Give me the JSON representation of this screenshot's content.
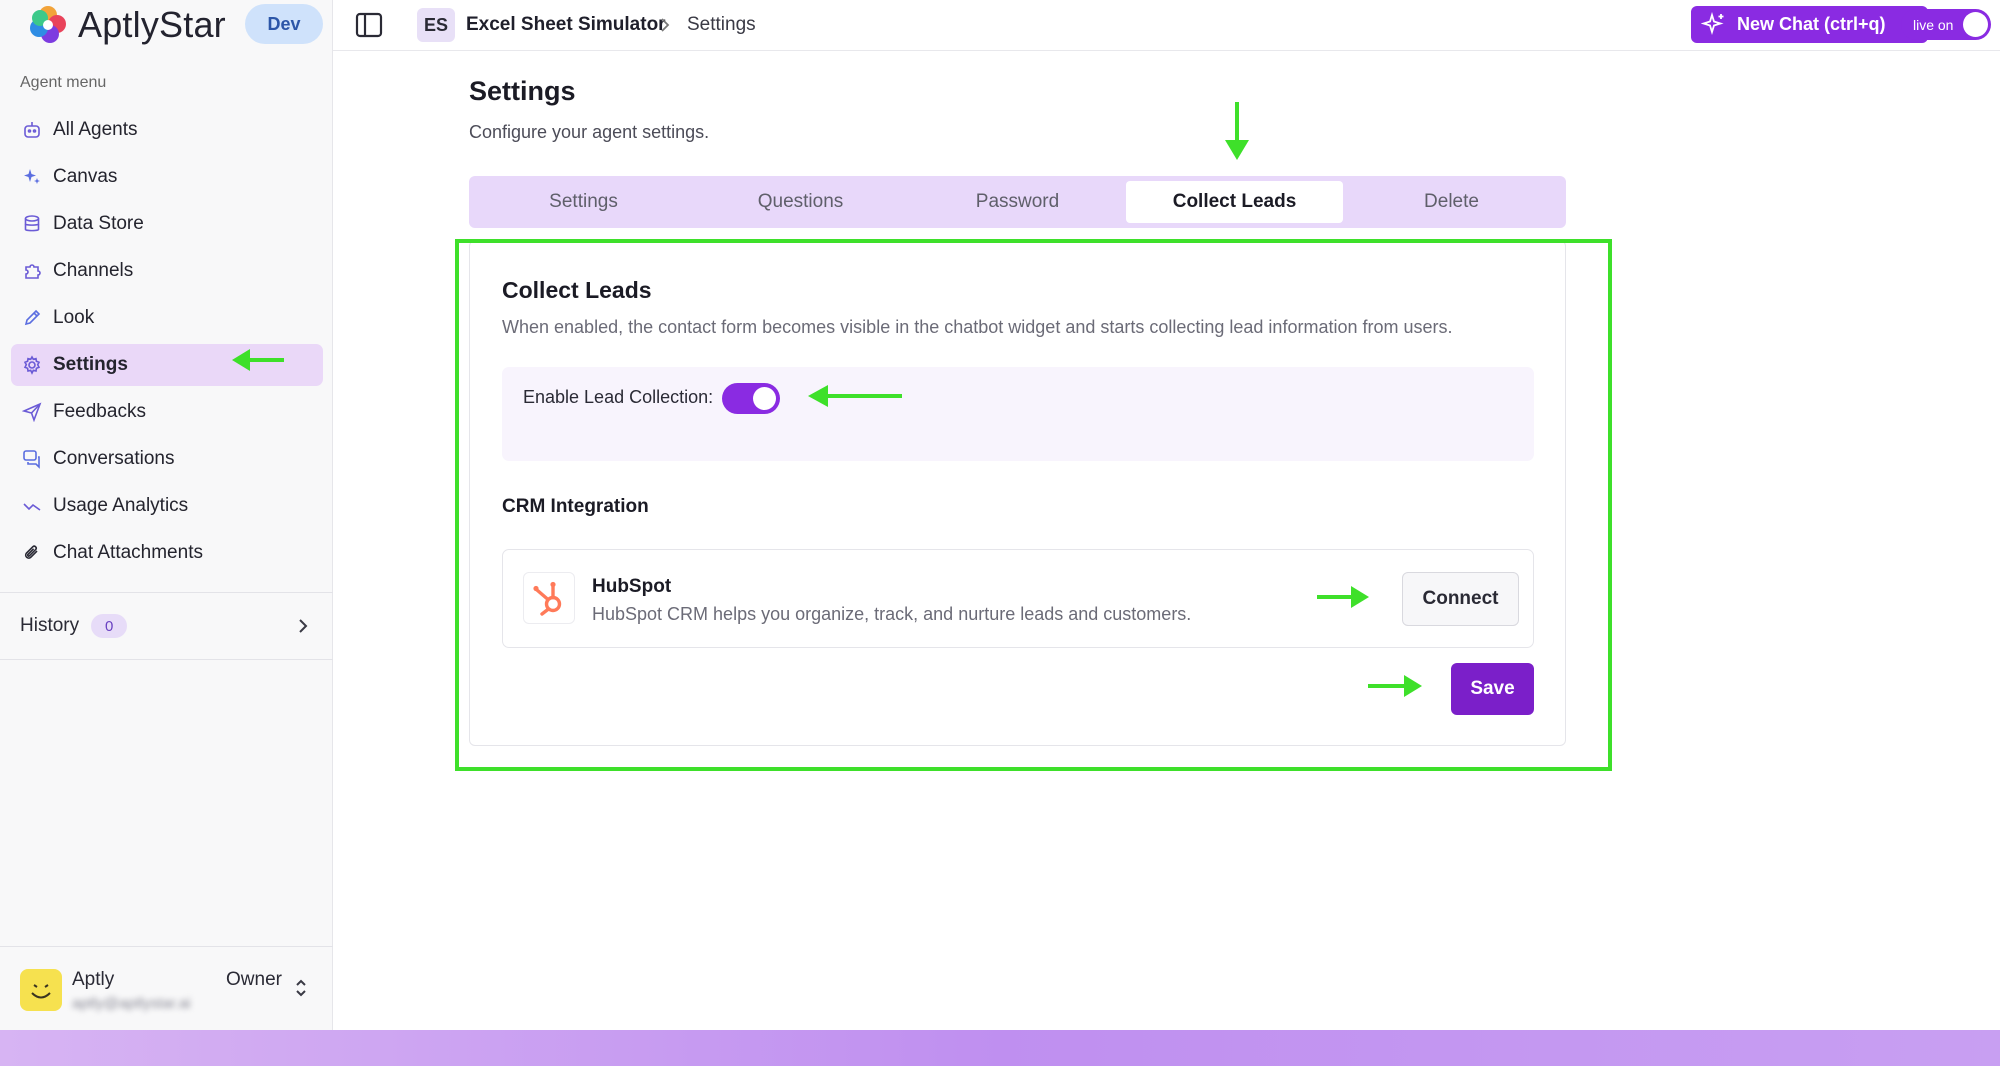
{
  "brand": {
    "name": "AptlyStar",
    "env_badge": "Dev"
  },
  "sidebar": {
    "section_label": "Agent menu",
    "items": [
      {
        "label": "All Agents",
        "icon": "robot-icon",
        "active": false
      },
      {
        "label": "Canvas",
        "icon": "sparkles-icon",
        "active": false
      },
      {
        "label": "Data Store",
        "icon": "database-icon",
        "active": false
      },
      {
        "label": "Channels",
        "icon": "puzzle-icon",
        "active": false
      },
      {
        "label": "Look",
        "icon": "eyedropper-icon",
        "active": false
      },
      {
        "label": "Settings",
        "icon": "gear-icon",
        "active": true
      },
      {
        "label": "Feedbacks",
        "icon": "send-icon",
        "active": false
      },
      {
        "label": "Conversations",
        "icon": "chat-icon",
        "active": false
      },
      {
        "label": "Usage Analytics",
        "icon": "trend-icon",
        "active": false
      },
      {
        "label": "Chat Attachments",
        "icon": "paperclip-icon",
        "active": false
      }
    ],
    "history": {
      "label": "History",
      "count": "0"
    },
    "user": {
      "name": "Aptly",
      "email": "aptly@aptlystar.ai",
      "role": "Owner"
    }
  },
  "topbar": {
    "project_initials": "ES",
    "project_name": "Excel Sheet Simulator",
    "current_page": "Settings",
    "new_chat_label": "New Chat (ctrl+q)",
    "live_label": "live on"
  },
  "main": {
    "title": "Settings",
    "subtitle": "Configure your agent settings.",
    "tabs": [
      {
        "label": "Settings",
        "active": false
      },
      {
        "label": "Questions",
        "active": false
      },
      {
        "label": "Password",
        "active": false
      },
      {
        "label": "Collect Leads",
        "active": true
      },
      {
        "label": "Delete",
        "active": false
      }
    ],
    "collect_leads": {
      "title": "Collect Leads",
      "description": "When enabled, the contact form becomes visible in the chatbot widget and starts collecting lead information from users.",
      "enable_label": "Enable Lead Collection",
      "enable_colon": ":",
      "enabled": true,
      "crm_title": "CRM Integration",
      "hubspot": {
        "name": "HubSpot",
        "description": "HubSpot CRM helps you organize, track, and nurture leads and customers.",
        "connect_label": "Connect"
      },
      "save_label": "Save"
    }
  },
  "colors": {
    "accent": "#8a2be2",
    "annotation_green": "#3ee02a",
    "hubspot_orange": "#ff7a59"
  }
}
